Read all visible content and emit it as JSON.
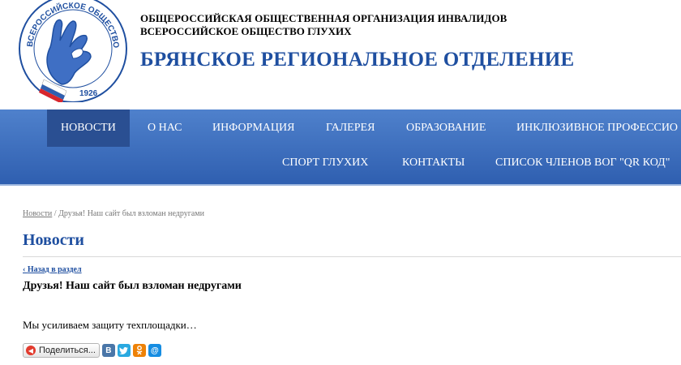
{
  "header": {
    "logo_text_top": "СКОЕ ОБЩЕСТВО",
    "logo_text_left": "ВСЕРОССИЙ",
    "logo_text_right": "ГЛУХИХ",
    "logo_year": "1926",
    "org_line1": "ОБЩЕРОССИЙСКАЯ ОБЩЕСТВЕННАЯ ОРГАНИЗАЦИЯ ИНВАЛИДОВ",
    "org_line2": "ВСЕРОССИЙСКОЕ ОБЩЕСТВО ГЛУХИХ",
    "region": "БРЯНСКОЕ РЕГИОНАЛЬНОЕ ОТДЕЛЕНИЕ"
  },
  "nav": {
    "row1": [
      "НОВОСТИ",
      "О НАС",
      "ИНФОРМАЦИЯ",
      "ГАЛЕРЕЯ",
      "ОБРАЗОВАНИЕ",
      "ИНКЛЮЗИВНОЕ ПРОФЕССИО"
    ],
    "row2": [
      "СПОРТ ГЛУХИХ",
      "КОНТАКТЫ",
      "СПИСОК ЧЛЕНОВ ВОГ \"QR КОД\""
    ],
    "active": "НОВОСТИ"
  },
  "breadcrumb": {
    "link": "Новости",
    "separator": " / ",
    "current": "Друзья! Наш сайт был взломан недругами"
  },
  "page_title": "Новости",
  "back_link": "Назад в раздел",
  "article": {
    "title": "Друзья! Наш сайт был взломан недругами",
    "body": "Мы усиливаем защиту техплощадки…"
  },
  "share": {
    "label": "Поделиться...",
    "services": [
      {
        "name": "vk",
        "glyph": "В",
        "color": "#4a76a8"
      },
      {
        "name": "twitter",
        "glyph": "t",
        "color": "#2aa9e0"
      },
      {
        "name": "odnoklassniki",
        "glyph": "ok",
        "color": "#ee8208"
      },
      {
        "name": "mail",
        "glyph": "@",
        "color": "#168de2"
      }
    ]
  },
  "colors": {
    "nav_top": "#4f81cc",
    "nav_bottom": "#2f5fb0",
    "nav_active": "#2a4f92",
    "title_blue": "#1f4fa0"
  }
}
